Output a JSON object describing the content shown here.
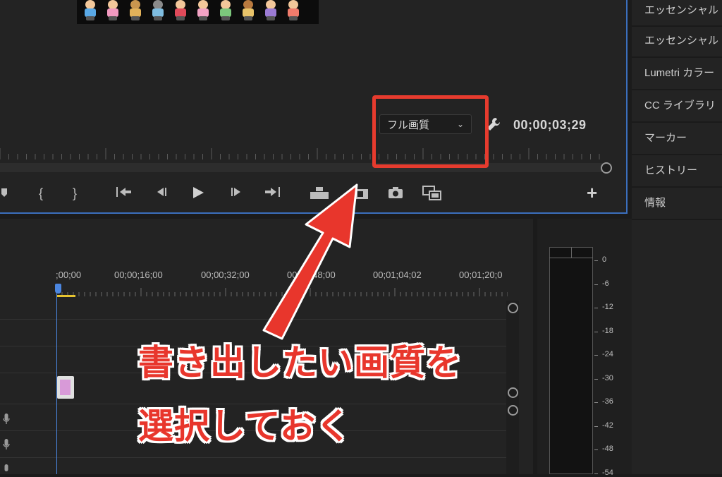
{
  "monitor": {
    "quality_select": {
      "value": "フル画質"
    },
    "timecode": "00;00;03;29"
  },
  "side_panel": {
    "items": [
      {
        "label": "エッセンシャル"
      },
      {
        "label": "エッセンシャル"
      },
      {
        "label": "Lumetri カラー"
      },
      {
        "label": "CC ライブラリ"
      },
      {
        "label": "マーカー"
      },
      {
        "label": "ヒストリー"
      },
      {
        "label": "情報"
      }
    ]
  },
  "timeline": {
    "timecodes": [
      ";00;00",
      "00;00;16;00",
      "00;00;32;00",
      "00;00;48;00",
      "00;01;04;02",
      "00;01;20;0"
    ]
  },
  "meter": {
    "db_labels": [
      "0",
      "-6",
      "-12",
      "-18",
      "-24",
      "-30",
      "-36",
      "-42",
      "-48",
      "-54"
    ]
  },
  "annotation": {
    "line1": "書き出したい画質を",
    "line2": "選択しておく",
    "color": "#e8362c"
  },
  "colors": {
    "panel_focus_border": "#3b6fbd",
    "playhead": "#4b86e0",
    "highlight": "#e63b2e"
  }
}
